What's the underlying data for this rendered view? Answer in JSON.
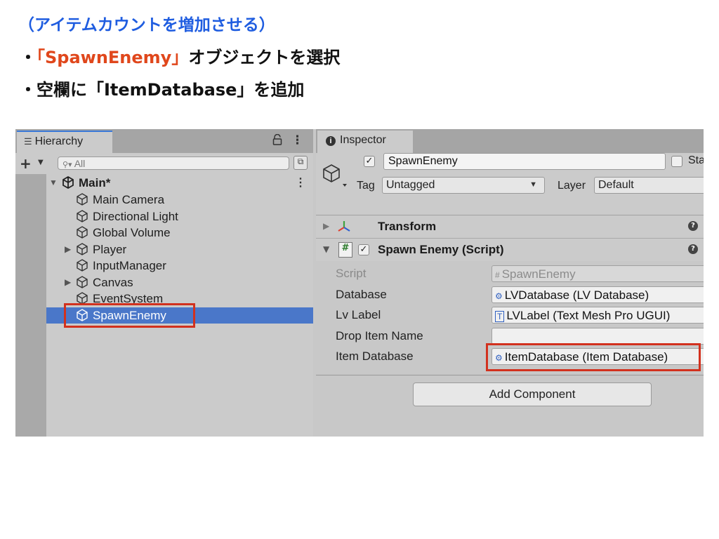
{
  "slide": {
    "heading": "（アイテムカウントを増加させる）",
    "bullet1_prefix": "・",
    "bullet1_highlight": "「SpawnEnemy」",
    "bullet1_rest": "オブジェクトを選択",
    "bullet2_prefix": "・",
    "bullet2_text": "空欄に「ItemDatabase」を追加"
  },
  "hierarchy": {
    "tab_label": "Hierarchy",
    "lock_icon": "lock-icon",
    "search_placeholder": "All",
    "scene_name": "Main*",
    "items": [
      {
        "label": "Main Camera",
        "expandable": false
      },
      {
        "label": "Directional Light",
        "expandable": false
      },
      {
        "label": "Global Volume",
        "expandable": false
      },
      {
        "label": "Player",
        "expandable": true
      },
      {
        "label": "InputManager",
        "expandable": false
      },
      {
        "label": "Canvas",
        "expandable": true
      },
      {
        "label": "EventSystem",
        "expandable": false
      },
      {
        "label": "SpawnEnemy",
        "expandable": false,
        "selected": true
      }
    ]
  },
  "inspector": {
    "tab_label": "Inspector",
    "object_name": "SpawnEnemy",
    "static_label": "Sta",
    "tag_label": "Tag",
    "tag_value": "Untagged",
    "layer_label": "Layer",
    "layer_value": "Default",
    "components": [
      {
        "title": "Transform"
      },
      {
        "title": "Spawn Enemy (Script)"
      }
    ],
    "properties": [
      {
        "label": "Script",
        "value": "SpawnEnemy",
        "disabled": true
      },
      {
        "label": "Database",
        "value": "LVDatabase (LV Database)"
      },
      {
        "label": "Lv Label",
        "value": "LVLabel (Text Mesh Pro UGUI)"
      },
      {
        "label": "Drop Item Name",
        "value": ""
      },
      {
        "label": "Item Database",
        "value": "ItemDatabase (Item Database)"
      }
    ],
    "add_component_label": "Add Component"
  },
  "colors": {
    "heading": "#1f5de0",
    "highlight": "#e0471c",
    "selection": "#4a77c9",
    "callout_box": "#d2311e"
  }
}
